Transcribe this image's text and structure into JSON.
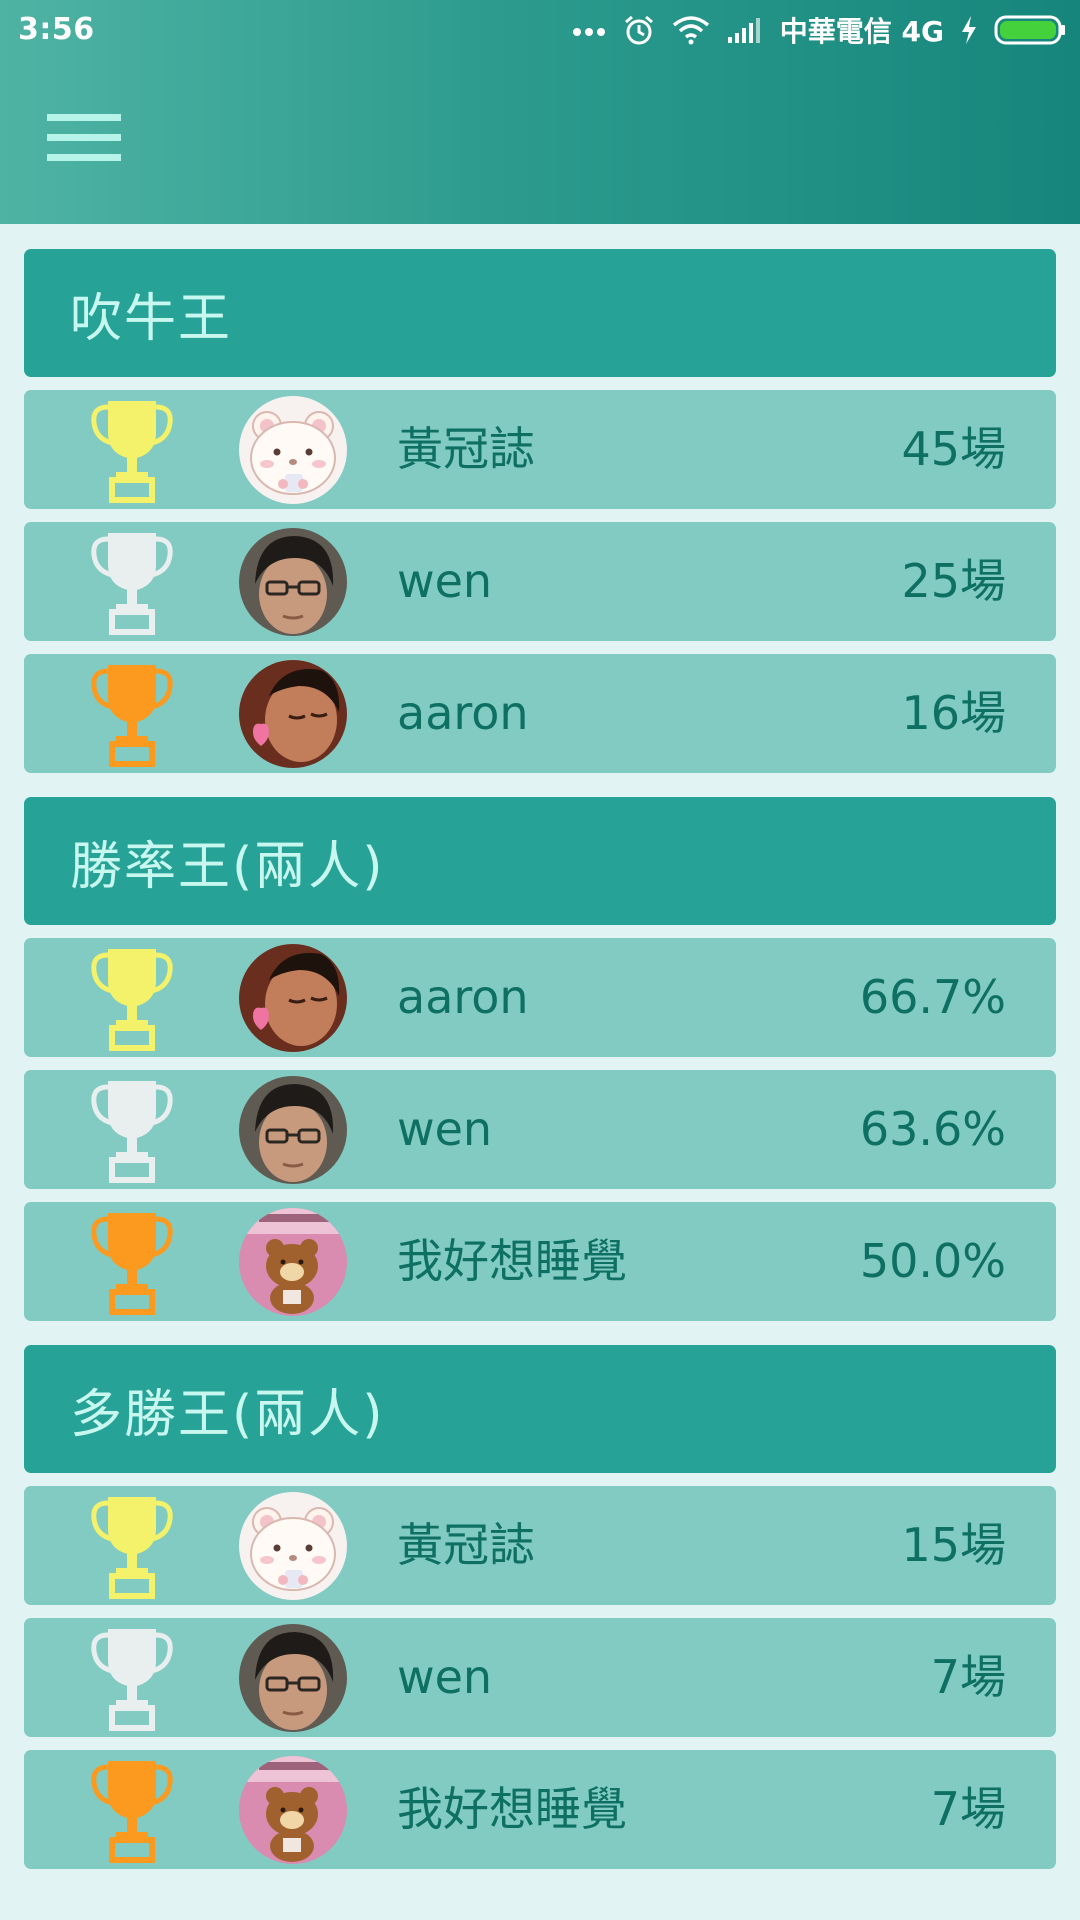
{
  "status_bar": {
    "time": "3:56",
    "carrier": "中華電信 4G",
    "icons": [
      "more-dots-icon",
      "alarm-icon",
      "wifi-icon",
      "signal-icon",
      "charging-icon",
      "battery-icon"
    ]
  },
  "app_bar": {
    "menu_icon": "hamburger-menu-icon"
  },
  "colors": {
    "app_bar_start": "#4fb3a3",
    "app_bar_end": "#16867c",
    "section_header": "#26a396",
    "row_background": "#82cbc2",
    "text_primary": "#0e6f63",
    "header_text": "#c8f7f0",
    "gold": "#f4f26a",
    "silver": "#e9efee",
    "bronze": "#fb9a1e",
    "page_background": "#e1f3f2"
  },
  "sections": [
    {
      "title": "吹牛王",
      "entries": [
        {
          "rank": 1,
          "trophy": "gold-trophy-icon",
          "avatar": "bear-avatar",
          "name": "黃冠誌",
          "score": "45場"
        },
        {
          "rank": 2,
          "trophy": "silver-trophy-icon",
          "avatar": "glasses-avatar",
          "name": "wen",
          "score": "25場"
        },
        {
          "rank": 3,
          "trophy": "bronze-trophy-icon",
          "avatar": "sleeping-avatar",
          "name": "aaron",
          "score": "16場"
        }
      ]
    },
    {
      "title": "勝率王(兩人)",
      "entries": [
        {
          "rank": 1,
          "trophy": "gold-trophy-icon",
          "avatar": "sleeping-avatar",
          "name": "aaron",
          "score": "66.7%"
        },
        {
          "rank": 2,
          "trophy": "silver-trophy-icon",
          "avatar": "glasses-avatar",
          "name": "wen",
          "score": "63.6%"
        },
        {
          "rank": 3,
          "trophy": "bronze-trophy-icon",
          "avatar": "rilakkuma-avatar",
          "name": "我好想睡覺",
          "score": "50.0%"
        }
      ]
    },
    {
      "title": "多勝王(兩人)",
      "entries": [
        {
          "rank": 1,
          "trophy": "gold-trophy-icon",
          "avatar": "bear-avatar",
          "name": "黃冠誌",
          "score": "15場"
        },
        {
          "rank": 2,
          "trophy": "silver-trophy-icon",
          "avatar": "glasses-avatar",
          "name": "wen",
          "score": "7場"
        },
        {
          "rank": 3,
          "trophy": "bronze-trophy-icon",
          "avatar": "rilakkuma-avatar",
          "name": "我好想睡覺",
          "score": "7場"
        }
      ]
    }
  ]
}
